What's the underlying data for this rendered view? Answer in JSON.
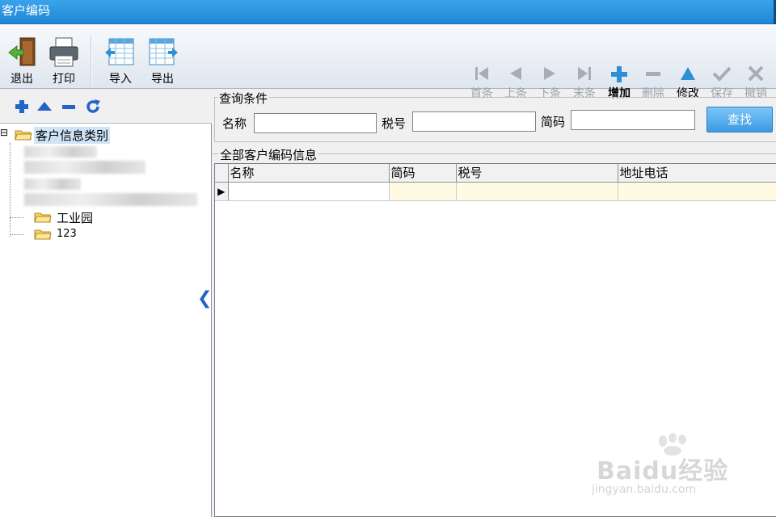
{
  "window": {
    "title": "客户编码"
  },
  "toolbar": {
    "exit": "退出",
    "print": "打印",
    "import": "导入",
    "export": "导出",
    "nav": {
      "first": "首条",
      "prev": "上条",
      "next": "下条",
      "last": "末条",
      "add": "增加",
      "delete": "删除",
      "modify": "修改",
      "save": "保存",
      "undo": "撤销"
    }
  },
  "tree": {
    "root": "客户信息类别",
    "toggle": "⊟",
    "children": [
      "工业园",
      "123"
    ]
  },
  "query": {
    "legend": "查询条件",
    "name_label": "名称",
    "tax_label": "税号",
    "short_label": "简码",
    "name_value": "",
    "tax_value": "",
    "short_value": "",
    "find_button": "查找"
  },
  "list": {
    "legend": "全部客户编码信息",
    "columns": [
      "名称",
      "简码",
      "税号",
      "地址电话"
    ],
    "row_marker": "▶"
  },
  "watermark": {
    "brand": "Baidu经验",
    "url": "jingyan.baidu.com"
  },
  "colors": {
    "titlebar": "#1f86d6",
    "accent": "#3b9be3",
    "icon_blue": "#2265c8",
    "row_highlight": "#fffbe3"
  }
}
